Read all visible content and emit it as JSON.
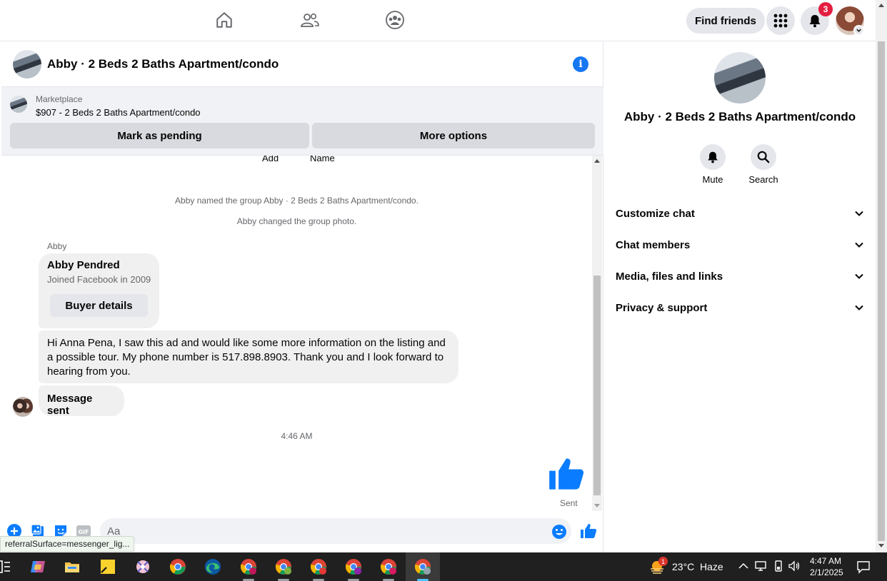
{
  "top_nav": {
    "find_friends_label": "Find friends",
    "notification_count": "3"
  },
  "chat": {
    "title": "Abby · 2 Beds 2 Baths Apartment/condo",
    "marketplace": {
      "label": "Marketplace",
      "listing": "$907 - 2 Beds 2 Baths Apartment/condo",
      "mark_pending_label": "Mark as pending",
      "more_options_label": "More options"
    },
    "clipped_labels": [
      "Add",
      "Name"
    ],
    "system_messages": [
      "Abby named the group Abby · 2 Beds 2 Baths Apartment/condo.",
      "Abby changed the group photo."
    ],
    "sender_name": "Abby",
    "buyer_card": {
      "name": "Abby Pendred",
      "joined": "Joined Facebook in 2009",
      "button_label": "Buyer details"
    },
    "message_text": "Hi Anna Pena, I saw this ad and would like some more information on the listing and a possible tour. My phone number is 517.898.8903. Thank you and I look forward to hearing from you.",
    "message_sent_text": "Message sent",
    "timestamp": "4:46 AM",
    "sent_label": "Sent",
    "composer_placeholder": "Aa"
  },
  "status_url": "referralSurface=messenger_lig...",
  "right_panel": {
    "title": "Abby · 2 Beds 2 Baths Apartment/condo",
    "actions": [
      {
        "label": "Mute",
        "icon": "bell-icon"
      },
      {
        "label": "Search",
        "icon": "search-icon"
      }
    ],
    "sections": [
      {
        "label": "Customize chat"
      },
      {
        "label": "Chat members"
      },
      {
        "label": "Media, files and links"
      },
      {
        "label": "Privacy & support"
      }
    ]
  },
  "taskbar": {
    "weather_temp": "23°C",
    "weather_desc": "Haze",
    "weather_badge": "1",
    "time": "4:47 AM",
    "date": "2/1/2025"
  },
  "colors": {
    "accent": "#1877f2",
    "badge": "#e41e3f",
    "bubble": "#f0f0f0",
    "taskbar": "#202020"
  }
}
